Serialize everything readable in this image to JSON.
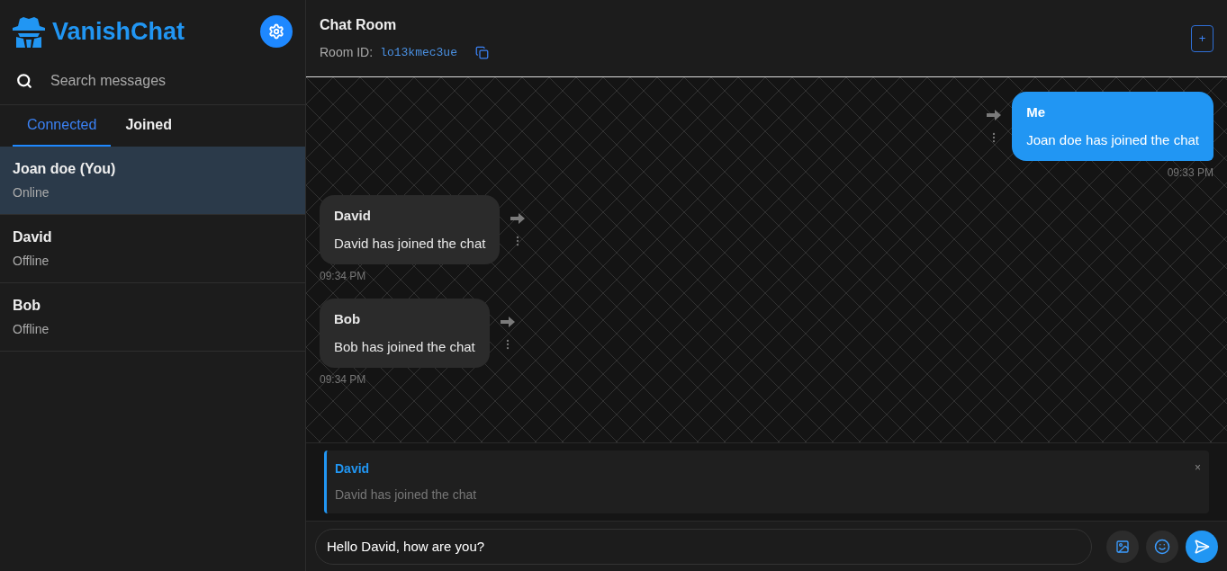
{
  "brand": {
    "name": "VanishChat"
  },
  "search": {
    "placeholder": "Search messages"
  },
  "tabs": [
    {
      "label": "Connected",
      "selected": true
    },
    {
      "label": "Joined",
      "selected": false
    }
  ],
  "contacts": [
    {
      "name": "Joan doe (You)",
      "status": "Online",
      "selected": true
    },
    {
      "name": "David",
      "status": "Offline",
      "selected": false
    },
    {
      "name": "Bob",
      "status": "Offline",
      "selected": false
    }
  ],
  "header": {
    "title": "Chat Room",
    "room_label": "Room ID:",
    "room_id": "lo13kmec3ue",
    "add_button": "+"
  },
  "messages": [
    {
      "sender": "Me",
      "text": "Joan doe has joined the chat",
      "time": "09:33 PM",
      "own": true
    },
    {
      "sender": "David",
      "text": "David has joined the chat",
      "time": "09:34 PM",
      "own": false
    },
    {
      "sender": "Bob",
      "text": "Bob has joined the chat",
      "time": "09:34 PM",
      "own": false
    }
  ],
  "reply": {
    "sender": "David",
    "text": "David has joined the chat",
    "close": "×"
  },
  "composer": {
    "value": "Hello David, how are you?"
  }
}
